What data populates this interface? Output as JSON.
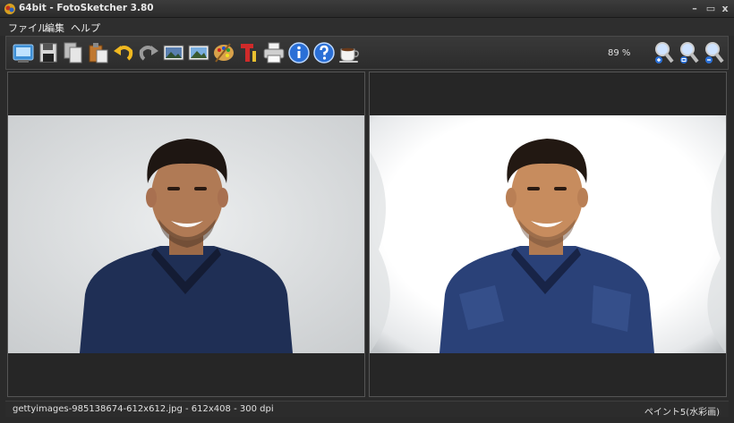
{
  "window": {
    "title": "64bit - FotoSketcher 3.80"
  },
  "window_controls": {
    "minimize": "–",
    "maximize": "▭",
    "close": "x"
  },
  "menu": [
    "ファイル",
    "編集",
    "ヘルプ"
  ],
  "toolbar": {
    "buttons": [
      {
        "name": "open-image-icon"
      },
      {
        "name": "save-icon"
      },
      {
        "name": "copy-icon"
      },
      {
        "name": "paste-icon"
      },
      {
        "name": "undo-icon"
      },
      {
        "name": "redo-icon"
      },
      {
        "name": "original-image-icon"
      },
      {
        "name": "landscape-image-icon"
      },
      {
        "name": "paint-palette-icon"
      },
      {
        "name": "text-tool-icon"
      },
      {
        "name": "print-icon"
      },
      {
        "name": "info-icon"
      },
      {
        "name": "help-icon"
      },
      {
        "name": "coffee-donate-icon"
      },
      {
        "name": "zoom-in-icon"
      },
      {
        "name": "zoom-fit-icon"
      },
      {
        "name": "zoom-out-icon"
      }
    ],
    "zoom_level": "89 %"
  },
  "status": {
    "file_info": "gettyimages-985138674-612x612.jpg - 612x408 - 300 dpi",
    "effect": "ペイント5(水彩画)"
  },
  "colors": {
    "background": "#2a2a2a",
    "shirt": "#1f2f55",
    "skin": "#b07a55",
    "hair": "#1e1612"
  }
}
